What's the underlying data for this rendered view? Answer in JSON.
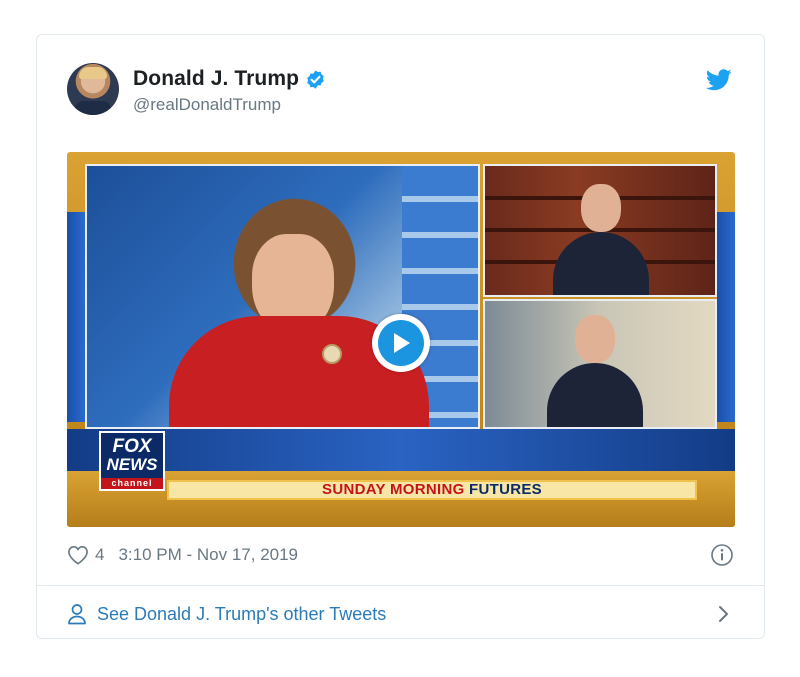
{
  "tweet": {
    "author_name": "Donald J. Trump",
    "author_handle": "@realDonaldTrump",
    "likes": "4",
    "timestamp": "3:10 PM - Nov 17, 2019",
    "footer_link": "See Donald J. Trump's other Tweets"
  },
  "media": {
    "network_logo_line1": "FOX",
    "network_logo_line2": "NEWS",
    "network_logo_line3": "channel",
    "show_title_word1": "SUNDAY MORNING",
    "show_title_word2": "FUTURES"
  },
  "colors": {
    "verified": "#1da1f2",
    "twitter_blue": "#1da1f2",
    "link": "#2b7bb9",
    "meta_gray": "#697882"
  },
  "icons": {
    "verified": "verified-badge-icon",
    "bird": "twitter-bird-icon",
    "play": "play-icon",
    "heart": "heart-icon",
    "info": "info-icon",
    "person": "person-icon",
    "chevron": "chevron-right-icon"
  }
}
